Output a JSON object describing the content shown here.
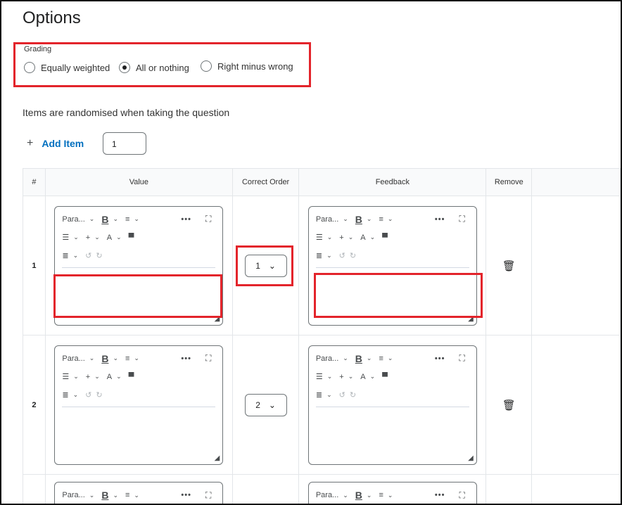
{
  "page": {
    "title": "Options"
  },
  "grading": {
    "label": "Grading",
    "options": [
      {
        "label": "Equally weighted",
        "selected": false
      },
      {
        "label": "All or nothing",
        "selected": true
      },
      {
        "label": "Right minus wrong",
        "selected": false
      }
    ]
  },
  "note": "Items are randomised when taking the question",
  "add_item": {
    "label": "Add Item",
    "count": "1",
    "icon": "plus-icon"
  },
  "table": {
    "headers": [
      "#",
      "Value",
      "Correct Order",
      "Feedback",
      "Remove"
    ],
    "rows": [
      {
        "num": "1",
        "order": "1"
      },
      {
        "num": "2",
        "order": "2"
      }
    ]
  },
  "editor_toolbar": {
    "format": "Para...",
    "bold": "B",
    "icons": [
      "align-icon",
      "more-icon",
      "fullscreen-icon",
      "list-icon",
      "insert-icon",
      "font-style-icon",
      "format-painter-icon",
      "word-count-icon",
      "undo-icon",
      "redo-icon"
    ]
  },
  "highlight_color": "#e3242b",
  "link_color": "#006fbf"
}
